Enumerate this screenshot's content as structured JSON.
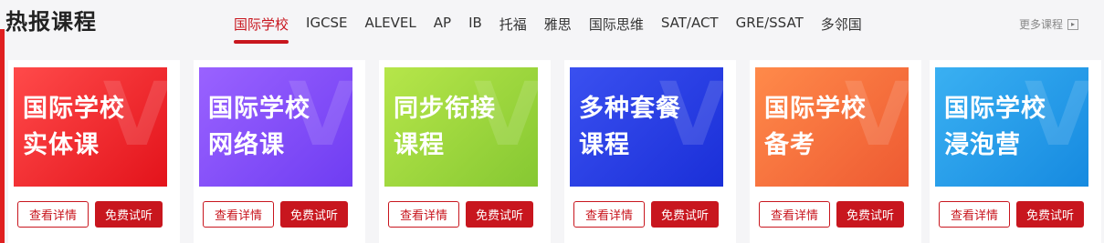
{
  "section": {
    "title": "热报课程",
    "more_label": "更多课程",
    "more_icon": "arrow-right-box-icon"
  },
  "tabs": [
    {
      "label": "国际学校",
      "active": true
    },
    {
      "label": "IGCSE"
    },
    {
      "label": "ALEVEL"
    },
    {
      "label": "AP"
    },
    {
      "label": "IB"
    },
    {
      "label": "托福"
    },
    {
      "label": "雅思"
    },
    {
      "label": "国际思维"
    },
    {
      "label": "SAT/ACT"
    },
    {
      "label": "GRE/SSAT"
    },
    {
      "label": "多邻国"
    }
  ],
  "colors": {
    "accent": "#c8161e"
  },
  "cards": [
    {
      "line1": "国际学校",
      "line2": "实体课",
      "detail": "查看详情",
      "trial": "免费试听",
      "gradient": [
        "#ff4a4a",
        "#e3131b"
      ]
    },
    {
      "line1": "国际学校",
      "line2": "网络课",
      "detail": "查看详情",
      "trial": "免费试听",
      "gradient": [
        "#9a62ff",
        "#6f3df2"
      ]
    },
    {
      "line1": "同步衔接",
      "line2": "课程",
      "detail": "查看详情",
      "trial": "免费试听",
      "gradient": [
        "#b6e64a",
        "#86c832"
      ]
    },
    {
      "line1": "多种套餐",
      "line2": "课程",
      "detail": "查看详情",
      "trial": "免费试听",
      "gradient": [
        "#3a50f0",
        "#1a2fd8"
      ]
    },
    {
      "line1": "国际学校",
      "line2": "备考",
      "detail": "查看详情",
      "trial": "免费试听",
      "gradient": [
        "#ff8a4a",
        "#ee5a32"
      ]
    },
    {
      "line1": "国际学校",
      "line2": "浸泡营",
      "detail": "查看详情",
      "trial": "免费试听",
      "gradient": [
        "#3ab0f2",
        "#168ae0"
      ]
    }
  ]
}
